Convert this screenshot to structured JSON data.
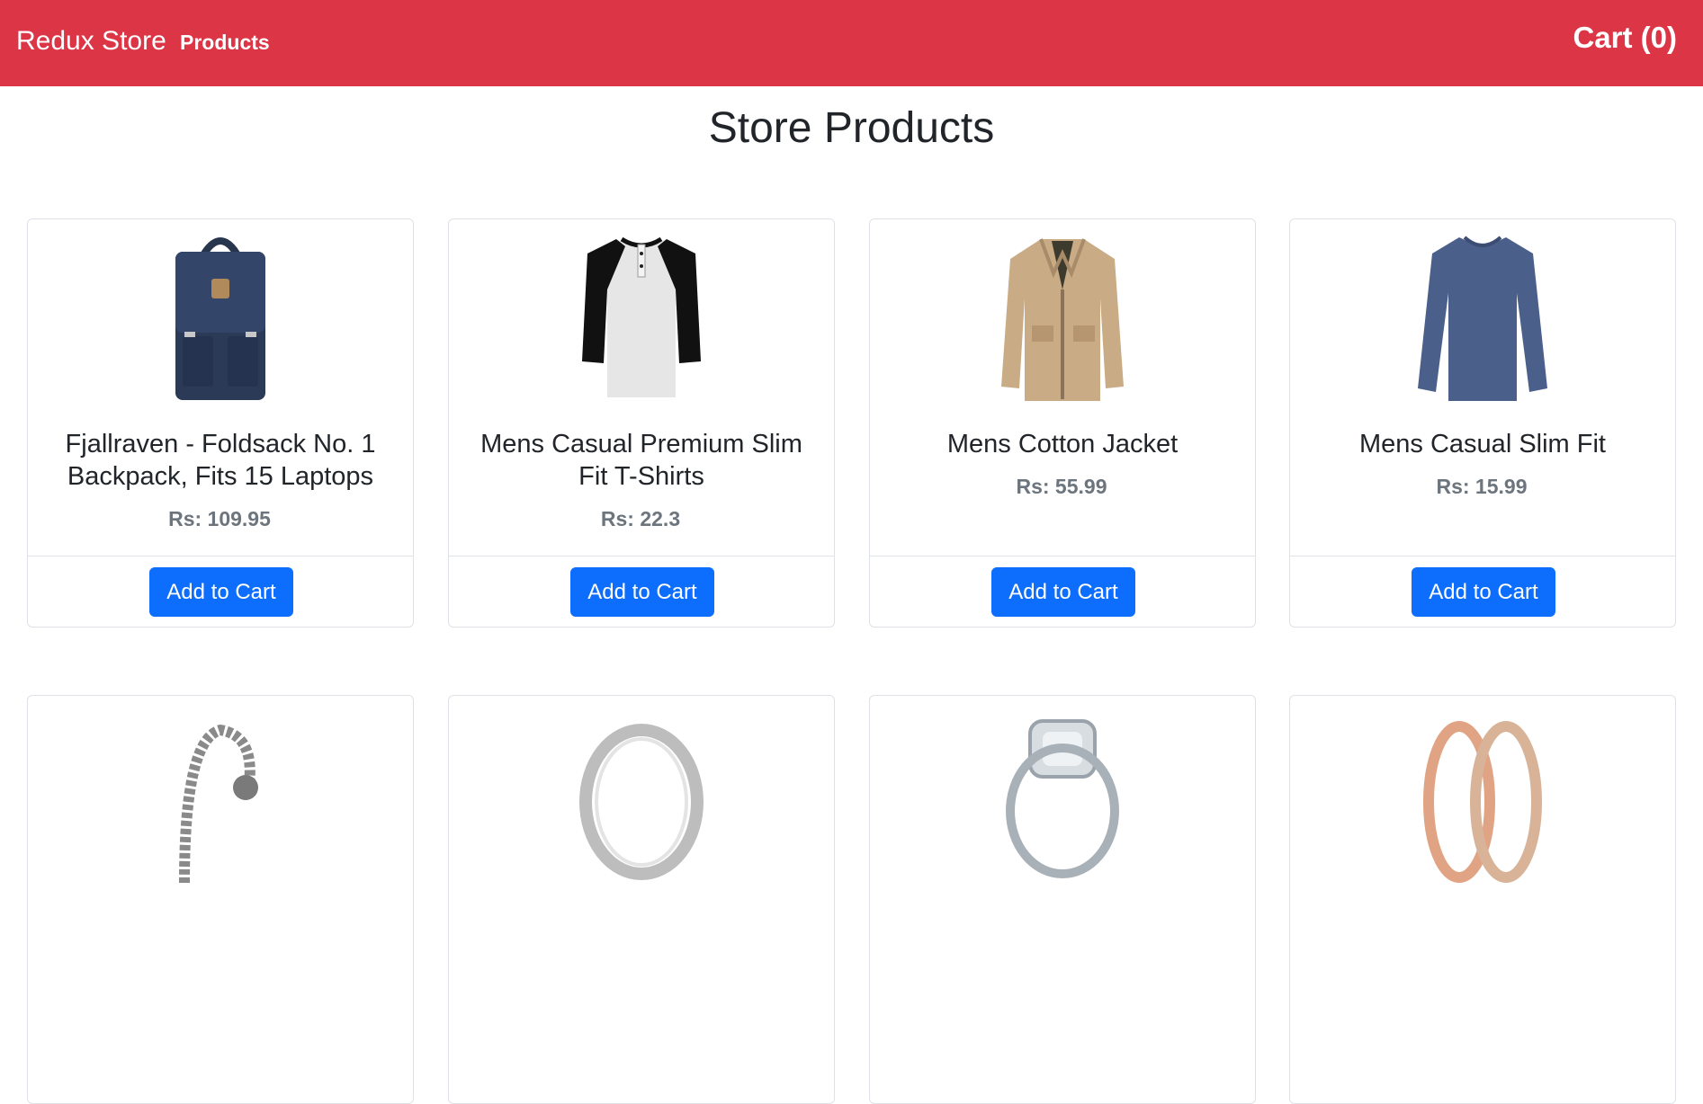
{
  "navbar": {
    "brand": "Redux Store",
    "products_link": "Products",
    "cart_label": "Cart (0)"
  },
  "page": {
    "title": "Store Products"
  },
  "products": [
    {
      "title": "Fjallraven - Foldsack No. 1 Backpack, Fits 15 Laptops",
      "price": "Rs: 109.95",
      "button": "Add to Cart",
      "image": "backpack-image"
    },
    {
      "title": "Mens Casual Premium Slim Fit T-Shirts",
      "price": "Rs: 22.3",
      "button": "Add to Cart",
      "image": "raglan-tshirt-image"
    },
    {
      "title": "Mens Cotton Jacket",
      "price": "Rs: 55.99",
      "button": "Add to Cart",
      "image": "cotton-jacket-image"
    },
    {
      "title": "Mens Casual Slim Fit",
      "price": "Rs: 15.99",
      "button": "Add to Cart",
      "image": "longsleeve-shirt-image"
    },
    {
      "image": "chain-bracelet-image"
    },
    {
      "image": "silver-ring-image"
    },
    {
      "image": "diamond-ring-image"
    },
    {
      "image": "rose-gold-ring-image"
    }
  ],
  "colors": {
    "navbar": "#dc3545",
    "button": "#0d6efd",
    "price": "#6c757d"
  }
}
